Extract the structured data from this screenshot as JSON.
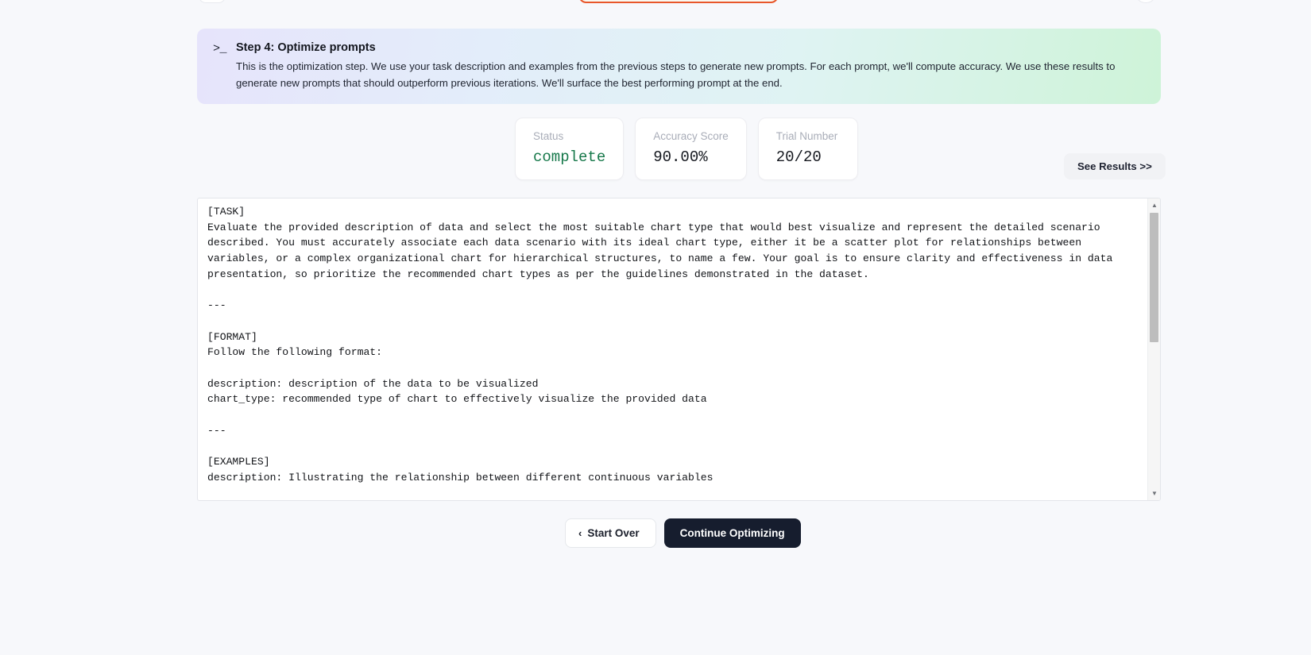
{
  "top_steps": {
    "left_chip_label": "",
    "center_chip_label": "",
    "right_chip_label": ""
  },
  "banner": {
    "icon": "prompt-terminal-icon",
    "icon_glyph": ">_",
    "title": "Step 4: Optimize prompts",
    "description": "This is the optimization step. We use your task description and examples from the previous steps to generate new prompts. For each prompt, we'll compute accuracy. We use these results to generate new prompts that should outperform previous iterations. We'll surface the best performing prompt at the end."
  },
  "metrics": [
    {
      "label": "Status",
      "value": "complete",
      "color": "#16784a",
      "green": true
    },
    {
      "label": "Accuracy Score",
      "value": "90.00%",
      "color": "#15181f",
      "green": false
    },
    {
      "label": "Trial Number",
      "value": "20/20",
      "color": "#15181f",
      "green": false
    }
  ],
  "actions": {
    "see_results_label": "See Results >>",
    "start_over_label": "Start Over",
    "start_over_chevron": "‹",
    "continue_label": "Continue Optimizing"
  },
  "prompt": {
    "content": "[TASK]\nEvaluate the provided description of data and select the most suitable chart type that would best visualize and represent the detailed scenario described. You must accurately associate each data scenario with its ideal chart type, either it be a scatter plot for relationships between variables, or a complex organizational chart for hierarchical structures, to name a few. Your goal is to ensure clarity and effectiveness in data presentation, so prioritize the recommended chart types as per the guidelines demonstrated in the dataset.\n\n---\n\n[FORMAT]\nFollow the following format:\n\ndescription: description of the data to be visualized\nchart_type: recommended type of chart to effectively visualize the provided data\n\n---\n\n[EXAMPLES]\ndescription: Illustrating the relationship between different continuous variables"
  },
  "scrollbar": {
    "up_arrow": "▲",
    "down_arrow": "▼",
    "thumb_position_percent": 0,
    "thumb_size_percent": 45
  }
}
